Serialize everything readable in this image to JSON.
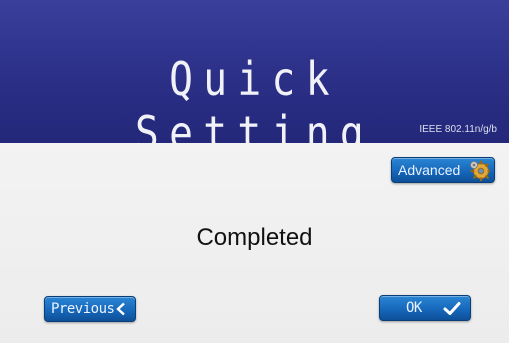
{
  "header": {
    "title": "Quick Setting",
    "standard": "IEEE 802.11n/g/b"
  },
  "buttons": {
    "advanced_label": "Advanced",
    "previous_label": "Previous",
    "ok_label": "OK"
  },
  "status": {
    "message": "Completed"
  },
  "icons": {
    "advanced": "gear-icon",
    "previous": "chevron-left-icon",
    "ok": "checkmark-icon"
  },
  "colors": {
    "header": "#2b2f86",
    "button": "#1565b8",
    "background": "#ececec"
  }
}
